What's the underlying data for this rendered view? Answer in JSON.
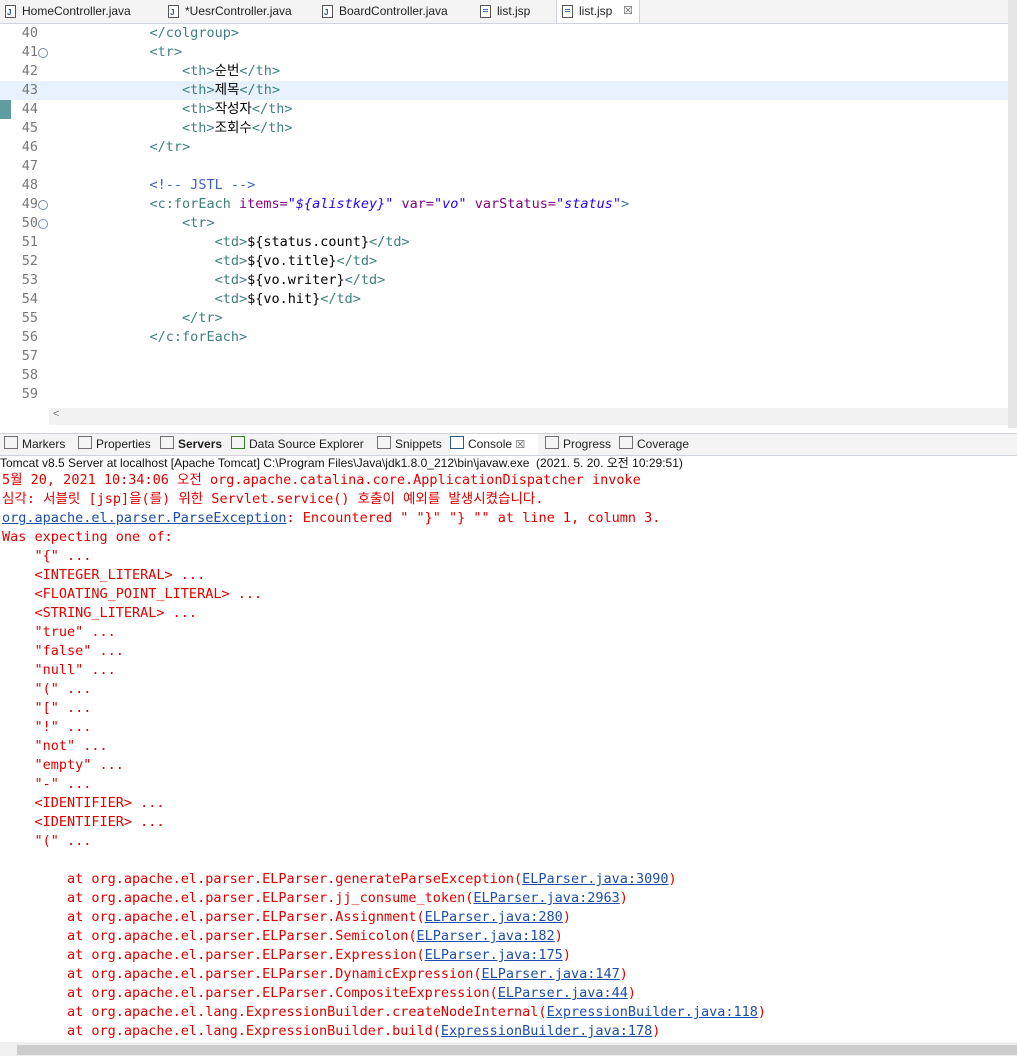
{
  "editor_tabs": [
    {
      "label": "HomeController.java",
      "icon": "java-file-icon"
    },
    {
      "label": "*UesrController.java",
      "icon": "java-file-icon"
    },
    {
      "label": "BoardController.java",
      "icon": "java-file-icon"
    },
    {
      "label": "list.jsp",
      "icon": "jsp-file-icon"
    },
    {
      "label": "list.jsp",
      "icon": "jsp-file-icon",
      "close": "☒"
    }
  ],
  "editor": {
    "lines": [
      {
        "num": "40",
        "text": "            </colgroup>"
      },
      {
        "num": "41",
        "text": "            <tr>",
        "fold": "⊖"
      },
      {
        "num": "42",
        "text": "                <th>순번</th>"
      },
      {
        "num": "43",
        "text": "                <th>제목</th>"
      },
      {
        "num": "44",
        "text": "                <th>작성자</th>"
      },
      {
        "num": "45",
        "text": "                <th>조회수</th>"
      },
      {
        "num": "46",
        "text": "            </tr>"
      },
      {
        "num": "47",
        "text": ""
      },
      {
        "num": "48",
        "text": "            <!-- JSTL -->"
      },
      {
        "num": "49",
        "text": "            <c:forEach items=\"${alistkey}\" var=\"vo\" varStatus=\"status\">",
        "fold": "⊖"
      },
      {
        "num": "50",
        "text": "                <tr>",
        "fold": "⊖"
      },
      {
        "num": "51",
        "text": "                    <td>${status.count}</td>"
      },
      {
        "num": "52",
        "text": "                    <td>${vo.title}</td>"
      },
      {
        "num": "53",
        "text": "                    <td>${vo.writer}</td>"
      },
      {
        "num": "54",
        "text": "                    <td>${vo.hit}</td>"
      },
      {
        "num": "55",
        "text": "                </tr>"
      },
      {
        "num": "56",
        "text": "            </c:forEach>"
      },
      {
        "num": "57",
        "text": ""
      },
      {
        "num": "58",
        "text": ""
      },
      {
        "num": "59",
        "text": ""
      }
    ],
    "scroll_left": "<"
  },
  "panel_tabs": [
    {
      "label": "Markers",
      "icon": "markers-icon"
    },
    {
      "label": "Properties",
      "icon": "properties-icon"
    },
    {
      "label": "Servers",
      "icon": "servers-icon"
    },
    {
      "label": "Data Source Explorer",
      "icon": "data-source-icon"
    },
    {
      "label": "Snippets",
      "icon": "snippets-icon"
    },
    {
      "label": "Console",
      "icon": "console-icon",
      "close": "☒"
    },
    {
      "label": "Progress",
      "icon": "progress-icon"
    },
    {
      "label": "Coverage",
      "icon": "coverage-icon"
    }
  ],
  "console_title": "Tomcat v8.5 Server at localhost [Apache Tomcat] C:\\Program Files\\Java\\jdk1.8.0_212\\bin\\javaw.exe  (2021. 5. 20. 오전 10:29:51)",
  "console_lines": [
    {
      "text": "5월 20, 2021 10:34:06 오전 org.apache.catalina.core.ApplicationDispatcher invoke"
    },
    {
      "text": "심각: 서블릿 [jsp]을(를) 위한 Servlet.service() 호출이 예외를 발생시켰습니다."
    },
    {
      "link": "org.apache.el.parser.ParseException",
      "text": ": Encountered \" \"}\" \"} \"\" at line 1, column 3."
    },
    {
      "text": "Was expecting one of:"
    },
    {
      "text": "    \"{\" ..."
    },
    {
      "text": "    <INTEGER_LITERAL> ..."
    },
    {
      "text": "    <FLOATING_POINT_LITERAL> ..."
    },
    {
      "text": "    <STRING_LITERAL> ..."
    },
    {
      "text": "    \"true\" ..."
    },
    {
      "text": "    \"false\" ..."
    },
    {
      "text": "    \"null\" ..."
    },
    {
      "text": "    \"(\" ..."
    },
    {
      "text": "    \"[\" ..."
    },
    {
      "text": "    \"!\" ..."
    },
    {
      "text": "    \"not\" ..."
    },
    {
      "text": "    \"empty\" ..."
    },
    {
      "text": "    \"-\" ..."
    },
    {
      "text": "    <IDENTIFIER> ..."
    },
    {
      "text": "    <IDENTIFIER> ..."
    },
    {
      "text": "    \"(\" ..."
    },
    {
      "text": ""
    },
    {
      "text": "        at org.apache.el.parser.ELParser.generateParseException(",
      "link2": "ELParser.java:3090",
      "after": ")"
    },
    {
      "text": "        at org.apache.el.parser.ELParser.jj_consume_token(",
      "link2": "ELParser.java:2963",
      "after": ")"
    },
    {
      "text": "        at org.apache.el.parser.ELParser.Assignment(",
      "link2": "ELParser.java:280",
      "after": ")"
    },
    {
      "text": "        at org.apache.el.parser.ELParser.Semicolon(",
      "link2": "ELParser.java:182",
      "after": ")"
    },
    {
      "text": "        at org.apache.el.parser.ELParser.Expression(",
      "link2": "ELParser.java:175",
      "after": ")"
    },
    {
      "text": "        at org.apache.el.parser.ELParser.DynamicExpression(",
      "link2": "ELParser.java:147",
      "after": ")"
    },
    {
      "text": "        at org.apache.el.parser.ELParser.CompositeExpression(",
      "link2": "ELParser.java:44",
      "after": ")"
    },
    {
      "text": "        at org.apache.el.lang.ExpressionBuilder.createNodeInternal(",
      "link2": "ExpressionBuilder.java:118",
      "after": ")"
    },
    {
      "text": "        at org.apache.el.lang.ExpressionBuilder.build(",
      "link2": "ExpressionBuilder.java:178",
      "after": ")"
    }
  ]
}
